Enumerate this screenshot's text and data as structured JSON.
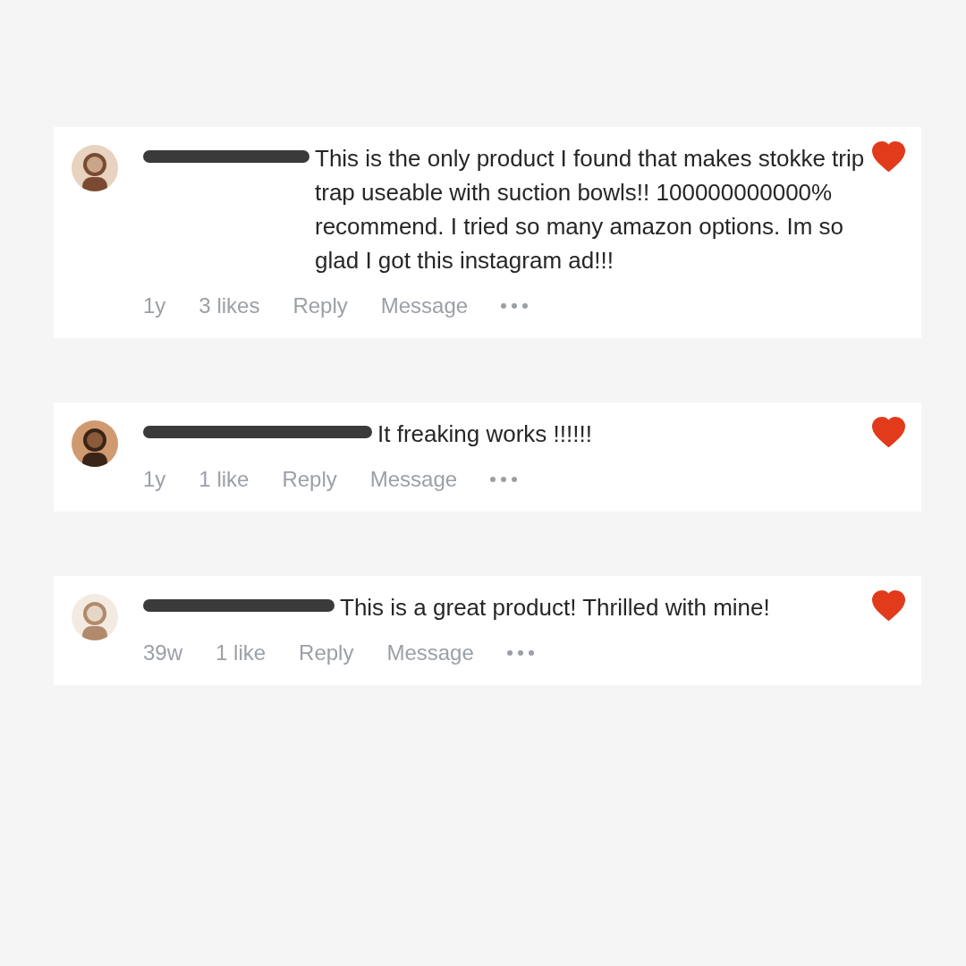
{
  "comments": [
    {
      "text": "This is the only product I found that makes stokke trip trap useable with suction bowls!! 100000000000% recommend. I tried so many amazon options. Im so glad I got this instagram ad!!!",
      "time": "1y",
      "likes": "3 likes",
      "reply": "Reply",
      "message": "Message",
      "liked": true
    },
    {
      "text": "It freaking works !!!!!!",
      "time": "1y",
      "likes": "1 like",
      "reply": "Reply",
      "message": "Message",
      "liked": true
    },
    {
      "text": "This is a great product! Thrilled with mine!",
      "time": "39w",
      "likes": "1 like",
      "reply": "Reply",
      "message": "Message",
      "liked": true
    }
  ]
}
